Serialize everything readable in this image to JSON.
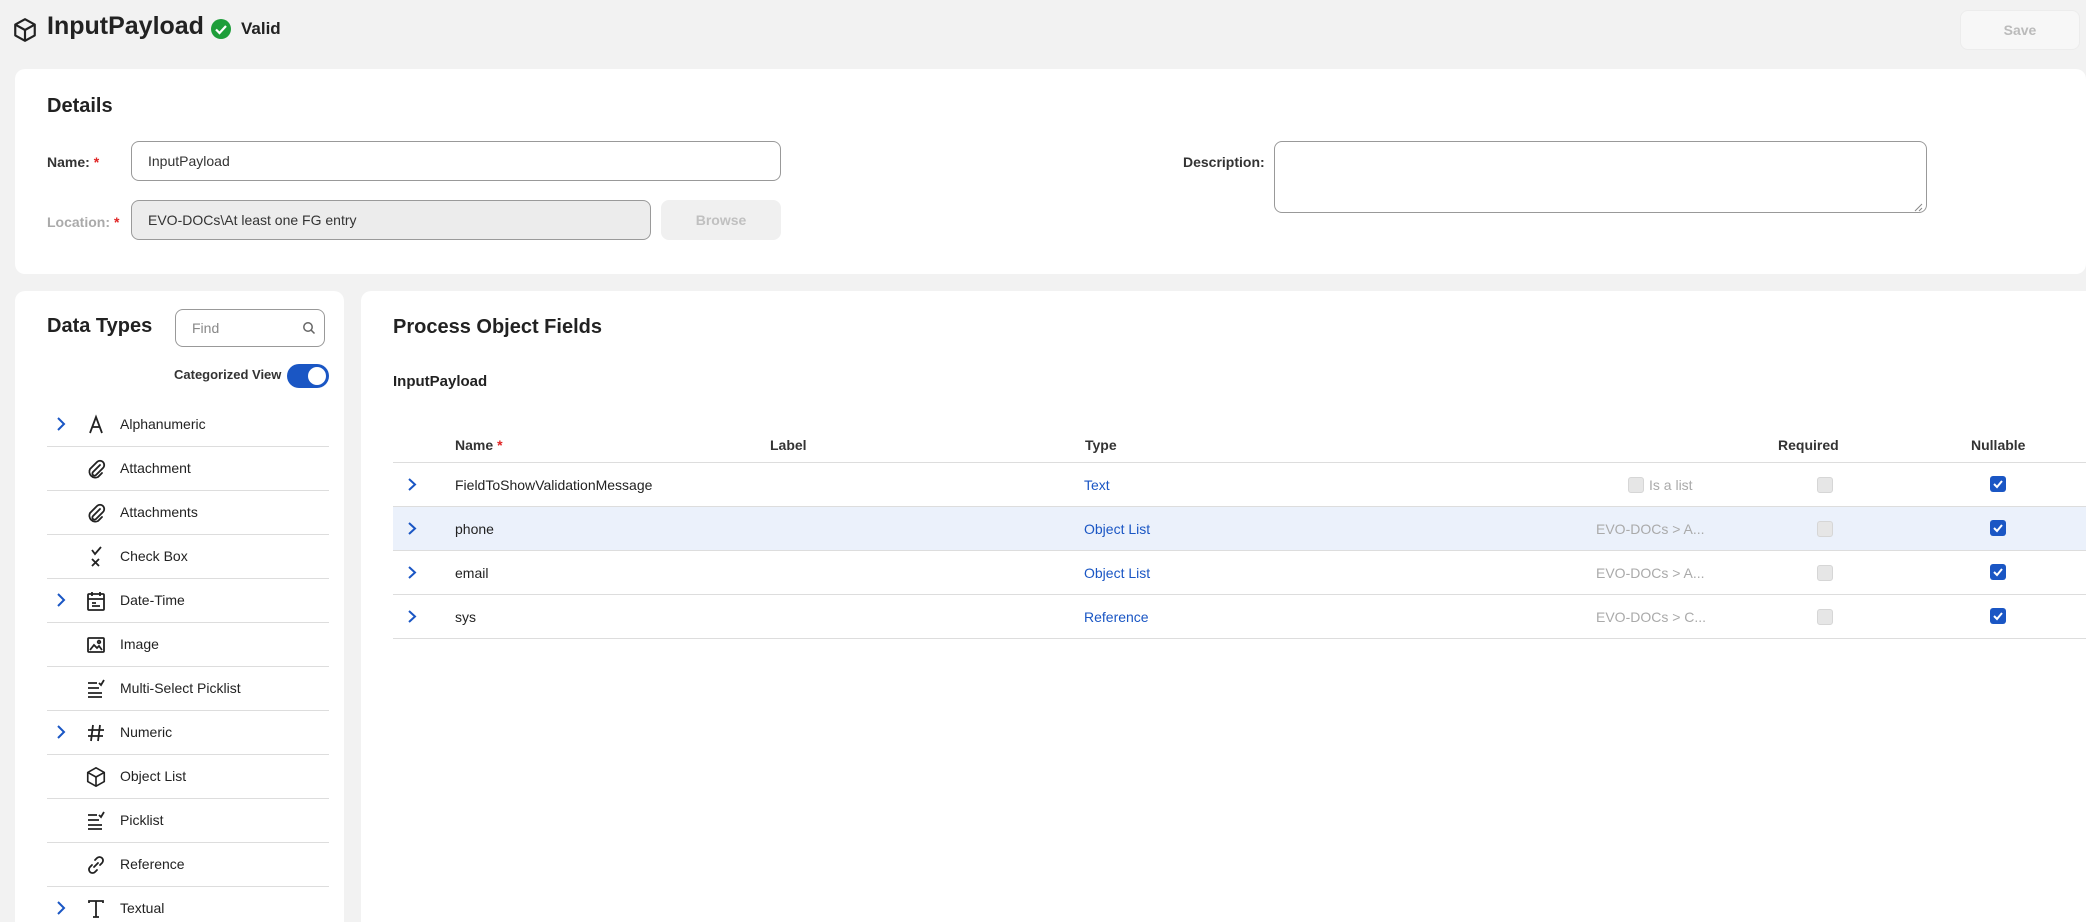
{
  "header": {
    "title": "InputPayload",
    "status": "Valid",
    "save_label": "Save"
  },
  "details": {
    "title": "Details",
    "name_label": "Name:",
    "name_value": "InputPayload",
    "location_label": "Location:",
    "location_value": "EVO-DOCs\\At least one FG entry",
    "browse_label": "Browse",
    "description_label": "Description:",
    "description_value": "",
    "required_marker": "*"
  },
  "data_types": {
    "title": "Data Types",
    "find_placeholder": "Find",
    "categorized_label": "Categorized View",
    "categorized_on": true,
    "items": [
      {
        "label": "Alphanumeric",
        "icon": "letter-a-icon",
        "expandable": true
      },
      {
        "label": "Attachment",
        "icon": "paperclip-icon",
        "expandable": false
      },
      {
        "label": "Attachments",
        "icon": "paperclip-icon",
        "expandable": false
      },
      {
        "label": "Check Box",
        "icon": "checkbox-icon",
        "expandable": false
      },
      {
        "label": "Date-Time",
        "icon": "calendar-icon",
        "expandable": true
      },
      {
        "label": "Image",
        "icon": "image-icon",
        "expandable": false
      },
      {
        "label": "Multi-Select Picklist",
        "icon": "list-check-icon",
        "expandable": false
      },
      {
        "label": "Numeric",
        "icon": "hash-icon",
        "expandable": true
      },
      {
        "label": "Object List",
        "icon": "cube-icon",
        "expandable": false
      },
      {
        "label": "Picklist",
        "icon": "list-check-icon",
        "expandable": false
      },
      {
        "label": "Reference",
        "icon": "link-icon",
        "expandable": false
      },
      {
        "label": "Textual",
        "icon": "letter-t-icon",
        "expandable": true
      }
    ]
  },
  "fields": {
    "title": "Process Object Fields",
    "object_name": "InputPayload",
    "columns": {
      "name": "Name",
      "label": "Label",
      "type": "Type",
      "required": "Required",
      "nullable": "Nullable"
    },
    "rows": [
      {
        "name": "FieldToShowValidationMessage",
        "label": "",
        "type": "Text",
        "extra": "",
        "is_list_label": "Is a list",
        "required": false,
        "nullable": true,
        "selected": false
      },
      {
        "name": "phone",
        "label": "",
        "type": "Object List",
        "extra": "EVO-DOCs > A...",
        "is_list_label": "",
        "required": false,
        "nullable": true,
        "selected": true
      },
      {
        "name": "email",
        "label": "",
        "type": "Object List",
        "extra": "EVO-DOCs > A...",
        "is_list_label": "",
        "required": false,
        "nullable": true,
        "selected": false
      },
      {
        "name": "sys",
        "label": "",
        "type": "Reference",
        "extra": "EVO-DOCs > C...",
        "is_list_label": "",
        "required": false,
        "nullable": true,
        "selected": false
      }
    ]
  },
  "colors": {
    "accent": "#1a56c4",
    "valid_green": "#1e9e3a",
    "required_red": "#e02424"
  }
}
